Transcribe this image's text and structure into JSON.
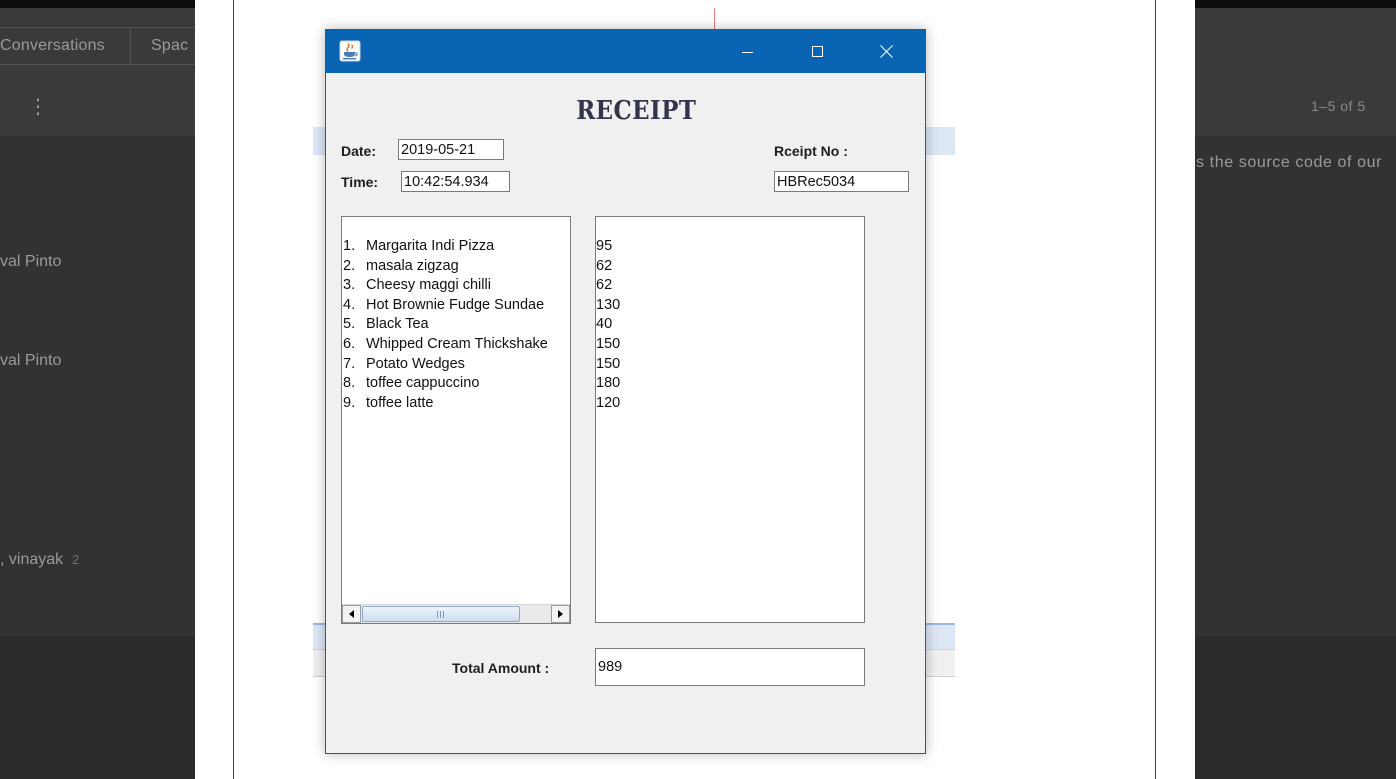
{
  "background_app": {
    "tabs": [
      {
        "label": "Conversations"
      },
      {
        "label": "Spac"
      }
    ],
    "more_icon": {
      "name": "more-vert-icon",
      "glyph": "⋮"
    },
    "conversations": [
      {
        "name": "val Pinto"
      },
      {
        "name": "val Pinto"
      },
      {
        "name": ", vinayak",
        "count": "2"
      }
    ],
    "pagination": "1–5 of 5",
    "snippet": "s the source code of our"
  },
  "receipt_window": {
    "icons": {
      "app": "java-coffee-icon",
      "minimize": "minimize-icon",
      "maximize": "maximize-icon",
      "close": "close-icon",
      "scroll_left": "scroll-left-arrow-icon",
      "scroll_right": "scroll-right-arrow-icon"
    },
    "heading": "RECEIPT",
    "date": {
      "label": "Date:",
      "value": "2019-05-21"
    },
    "time": {
      "label": "Time:",
      "value": "10:42:54.934"
    },
    "receipt_no": {
      "label": "Rceipt No :",
      "value": "HBRec5034"
    },
    "items": [
      {
        "number": "1.",
        "name": "Margarita Indi Pizza"
      },
      {
        "number": "2.",
        "name": "masala zigzag"
      },
      {
        "number": "3.",
        "name": "Cheesy maggi chilli"
      },
      {
        "number": "4.",
        "name": "Hot Brownie Fudge Sundae"
      },
      {
        "number": "5.",
        "name": "Black Tea"
      },
      {
        "number": "6.",
        "name": "Whipped Cream Thickshake"
      },
      {
        "number": "7.",
        "name": "Potato Wedges"
      },
      {
        "number": "8.",
        "name": "toffee cappuccino"
      },
      {
        "number": "9.",
        "name": "toffee latte"
      }
    ],
    "prices": [
      "95",
      "62",
      "62",
      "130",
      "40",
      "150",
      "150",
      "180",
      "120"
    ],
    "total": {
      "label": "Total Amount :",
      "value": "989"
    }
  },
  "colors": {
    "title_bar": "#0a64b4",
    "window_bg": "#f0f0f0",
    "heading": "#33364a",
    "dim_body": "#323232",
    "dim_header": "#3a3a3a",
    "dim_footer": "#2c2c2c",
    "dim_topbar": "#0d0d0d",
    "dim_text": "#9a9a9a"
  }
}
